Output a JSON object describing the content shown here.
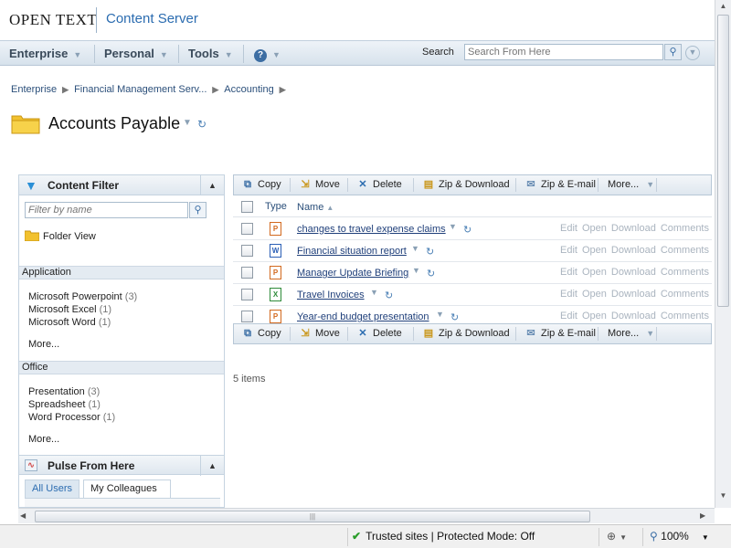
{
  "header": {
    "logo_text": "OPEN TEXT",
    "product": "Content Server"
  },
  "nav": {
    "items": [
      {
        "label": "Enterprise"
      },
      {
        "label": "Personal"
      },
      {
        "label": "Tools"
      }
    ],
    "help_icon": "help-icon",
    "search_label": "Search",
    "search_placeholder": "Search From Here"
  },
  "breadcrumb": [
    "Enterprise",
    "Financial Management Serv...",
    "Accounting"
  ],
  "page": {
    "title": "Accounts Payable"
  },
  "content_filter": {
    "title": "Content Filter",
    "filter_placeholder": "Filter by name",
    "folder_view": "Folder View",
    "sections": [
      {
        "title": "Application",
        "items": [
          {
            "label": "Microsoft Powerpoint",
            "count": "(3)"
          },
          {
            "label": "Microsoft Excel",
            "count": "(1)"
          },
          {
            "label": "Microsoft Word",
            "count": "(1)"
          }
        ],
        "more": "More..."
      },
      {
        "title": "Office",
        "items": [
          {
            "label": "Presentation",
            "count": "(3)"
          },
          {
            "label": "Spreadsheet",
            "count": "(1)"
          },
          {
            "label": "Word Processor",
            "count": "(1)"
          }
        ],
        "more": "More..."
      }
    ]
  },
  "pulse": {
    "title": "Pulse From Here",
    "tabs": [
      "All Users",
      "My Colleagues"
    ]
  },
  "toolbar": {
    "copy": "Copy",
    "move": "Move",
    "delete": "Delete",
    "zip_download": "Zip & Download",
    "zip_email": "Zip & E-mail",
    "more": "More..."
  },
  "list": {
    "col_type": "Type",
    "col_name": "Name",
    "actions": [
      "Edit",
      "Open",
      "Download",
      "Comments"
    ],
    "rows": [
      {
        "name": "changes to travel expense claims",
        "type": "powerpoint",
        "color": "#d2691e"
      },
      {
        "name": "Financial situation report",
        "type": "word",
        "color": "#2b5fb5"
      },
      {
        "name": "Manager Update Briefing",
        "type": "powerpoint",
        "color": "#d2691e"
      },
      {
        "name": "Travel Invoices",
        "type": "excel",
        "color": "#2e8b3a"
      },
      {
        "name": "Year-end budget presentation",
        "type": "powerpoint",
        "color": "#d2691e"
      }
    ],
    "count": "5 items"
  },
  "statusbar": {
    "zone": "Trusted sites | Protected Mode: Off",
    "zoom": "100%"
  }
}
